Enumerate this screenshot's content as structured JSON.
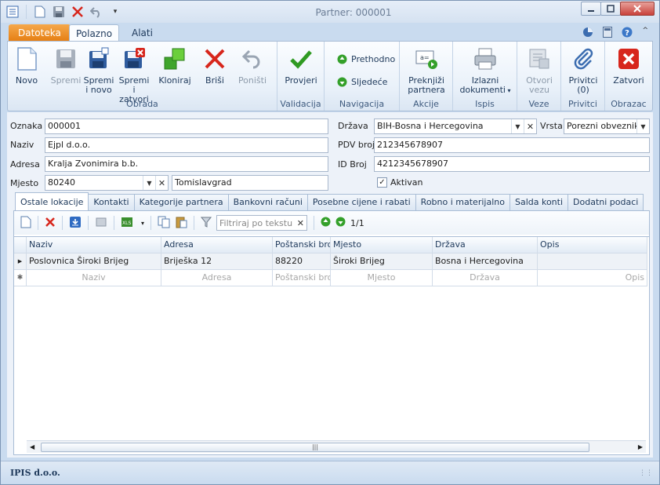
{
  "window": {
    "title": "Partner: 000001"
  },
  "ribbon_tabs": {
    "file": "Datoteka",
    "home": "Polazno",
    "tools": "Alati"
  },
  "ribbon": {
    "obrada": {
      "label": "Obrada",
      "novo": "Novo",
      "spremi": "Spremi",
      "spremi_novo_1": "Spremi",
      "spremi_novo_2": "i novo",
      "spremi_zatvori_1": "Spremi i",
      "spremi_zatvori_2": "zatvori",
      "kloniraj": "Kloniraj",
      "brisi": "Briši",
      "ponisti": "Poništi"
    },
    "validacija": {
      "label": "Validacija",
      "provjeri": "Provjeri"
    },
    "navigacija": {
      "label": "Navigacija",
      "prethodno": "Prethodno",
      "sljedece": "Sljedeće"
    },
    "akcije": {
      "label": "Akcije",
      "preknjizi_1": "Preknjiži",
      "preknjizi_2": "partnera"
    },
    "ispis": {
      "label": "Ispis",
      "izlazni_1": "Izlazni",
      "izlazni_2": "dokumenti"
    },
    "veze": {
      "label": "Veze",
      "otvori_1": "Otvori",
      "otvori_2": "vezu"
    },
    "privitci": {
      "label": "Privitci",
      "privitci_1": "Privitci",
      "privitci_2": "(0)"
    },
    "obrazac": {
      "label": "Obrazac",
      "zatvori": "Zatvori"
    }
  },
  "form": {
    "oznaka_label": "Oznaka",
    "oznaka_value": "000001",
    "naziv_label": "Naziv",
    "naziv_value": "Ejpl d.o.o.",
    "adresa_label": "Adresa",
    "adresa_value": "Kralja Zvonimira b.b.",
    "mjesto_label": "Mjesto",
    "mjesto_code": "80240",
    "mjesto_name": "Tomislavgrad",
    "drzava_label": "Država",
    "drzava_value": "BIH-Bosna i Hercegovina",
    "vrsta_label": "Vrsta",
    "vrsta_value": "Porezni obveznik",
    "pdv_label": "PDV broj",
    "pdv_value": "212345678907",
    "idbroj_label": "ID Broj",
    "idbroj_value": "4212345678907",
    "aktivan_label": "Aktivan"
  },
  "tabs": [
    {
      "label": "Ostale lokacije"
    },
    {
      "label": "Kontakti"
    },
    {
      "label": "Kategorije partnera"
    },
    {
      "label": "Bankovni računi"
    },
    {
      "label": "Posebne cijene i rabati"
    },
    {
      "label": "Robno i materijalno"
    },
    {
      "label": "Salda konti"
    },
    {
      "label": "Dodatni podaci"
    }
  ],
  "grid_toolbar": {
    "filter_placeholder": "Filtriraj po tekstu",
    "record_counter": "1/1"
  },
  "grid": {
    "columns": [
      "Naziv",
      "Adresa",
      "Poštanski broj",
      "Mjesto",
      "Država",
      "Opis"
    ],
    "rows": [
      [
        "Poslovnica Široki Brijeg",
        "Briješka 12",
        "88220",
        "Široki Brijeg",
        "Bosna i Hercegovina",
        ""
      ]
    ],
    "new_row": [
      "Naziv",
      "Adresa",
      "Poštanski broj",
      "Mjesto",
      "Država",
      "Opis"
    ]
  },
  "status": {
    "company": "IPIS d.o.o."
  }
}
